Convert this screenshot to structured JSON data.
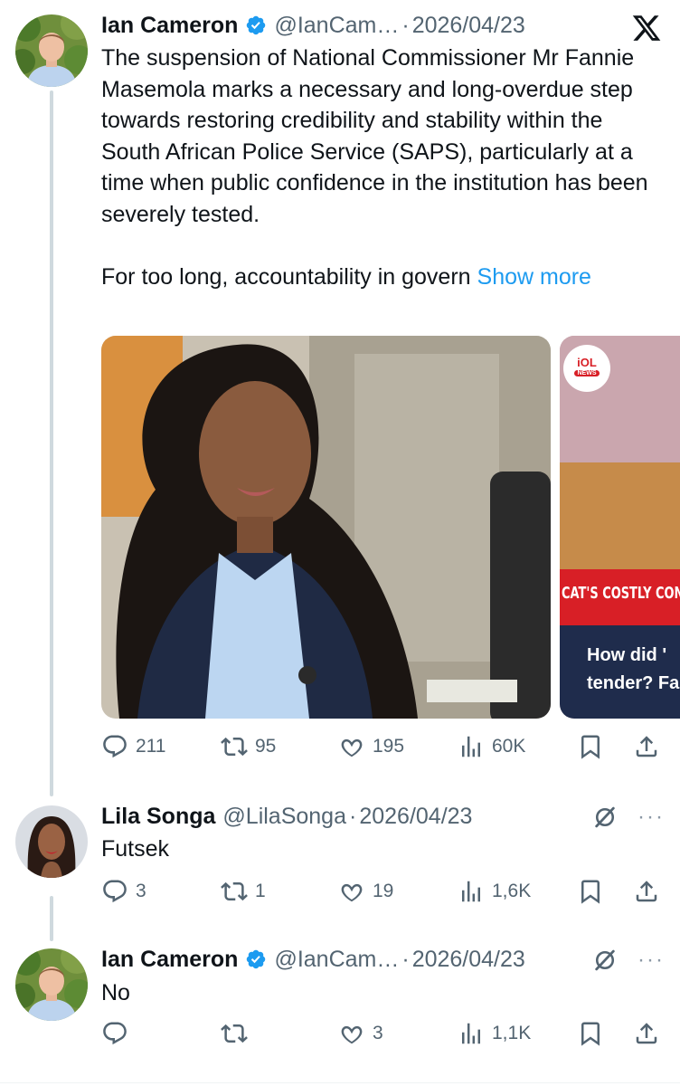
{
  "tweets": [
    {
      "author": "Ian Cameron",
      "handle": "@IanCam…",
      "date": "2026/04/23",
      "dot": "·",
      "text": "The suspension of National Commissioner Mr Fannie Masemola marks a necessary and long-overdue step towards restoring credibility and stability within the South African Police Service (SAPS), particularly at a time when public confidence in the institution has been severely tested.\n\nFor too long, accountability in govern ",
      "show_more": "Show more",
      "media": {
        "second_image_badge": "iOL",
        "second_image_badge_sub": "NEWS",
        "second_image_banner": "CAT'S COSTLY CONT",
        "second_image_caption_1": "How did '",
        "second_image_caption_2": "tender? Fa"
      },
      "stats": {
        "replies": "211",
        "reposts": "95",
        "likes": "195",
        "views": "60K"
      }
    },
    {
      "author": "Lila Songa",
      "handle": "@LilaSonga",
      "date": "2026/04/23",
      "dot": "·",
      "text": "Futsek",
      "stats": {
        "replies": "3",
        "reposts": "1",
        "likes": "19",
        "views": "1,6K"
      }
    },
    {
      "author": "Ian Cameron",
      "handle": "@IanCam…",
      "date": "2026/04/23",
      "dot": "·",
      "text": "No",
      "stats": {
        "replies": "",
        "reposts": "",
        "likes": "3",
        "views": "1,1K"
      }
    }
  ],
  "overflow_label": "···",
  "colors": {
    "text": "#0f1419",
    "secondary": "#536471",
    "accent": "#1d9bf0",
    "thread_line": "#cfd9de"
  },
  "icons": [
    "x-logo-icon",
    "verified-badge-icon",
    "reply-icon",
    "repost-icon",
    "like-icon",
    "views-icon",
    "bookmark-icon",
    "share-icon",
    "grok-icon",
    "more-icon"
  ]
}
